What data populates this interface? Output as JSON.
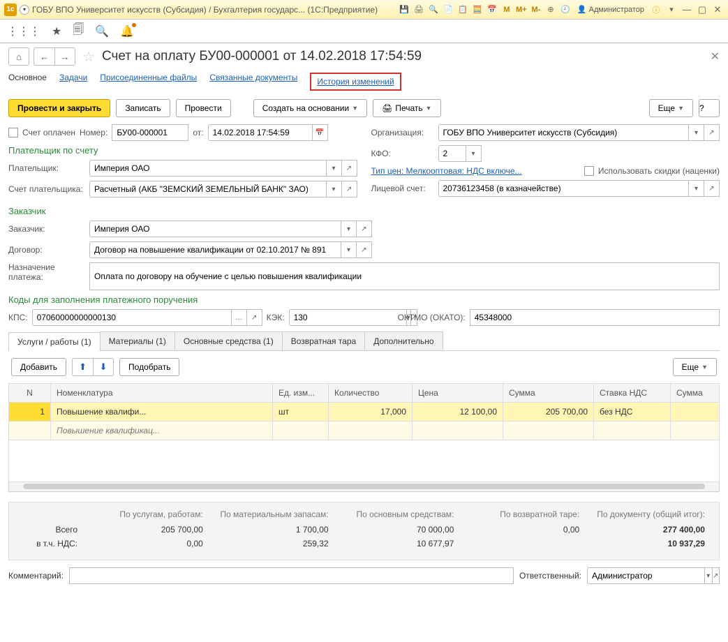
{
  "system": {
    "title": "ГОБУ ВПО Университет искусств (Субсидия) / Бухгалтерия государс... (1С:Предприятие)",
    "user": "Администратор"
  },
  "header": {
    "title": "Счет на оплату БУ00-000001 от 14.02.2018 17:54:59"
  },
  "nav": {
    "main": "Основное",
    "tasks": "Задачи",
    "files": "Присоединенные файлы",
    "linked": "Связанные документы",
    "history": "История изменений"
  },
  "cmd": {
    "post_close": "Провести и закрыть",
    "save": "Записать",
    "post": "Провести",
    "create_based": "Создать на основании",
    "print": "Печать",
    "more": "Еще",
    "help": "?"
  },
  "fields": {
    "paid_label": "Счет оплачен",
    "number_label": "Номер:",
    "number_value": "БУ00-000001",
    "from_label": "от:",
    "date_value": "14.02.2018 17:54:59",
    "org_label": "Организация:",
    "org_value": "ГОБУ ВПО Университет искусств (Субсидия)",
    "kfo_label": "КФО:",
    "kfo_value": "2",
    "payer_section": "Плательщик по счету",
    "payer_label": "Плательщик:",
    "payer_value": "Империя ОАО",
    "payer_acc_label": "Счет плательщика:",
    "payer_acc_value": "Расчетный (АКБ \"ЗЕМСКИЙ ЗЕМЕЛЬНЫЙ БАНК\" ЗАО)",
    "price_type_link": "Тип цен: Мелкооптовая: НДС включе...",
    "discount_label": "Использовать скидки (наценки)",
    "personal_acc_label": "Лицевой счет:",
    "personal_acc_value": "20736123458 (в казначействе)",
    "customer_section": "Заказчик",
    "customer_label": "Заказчик:",
    "customer_value": "Империя ОАО",
    "contract_label": "Договор:",
    "contract_value": "Договор на повышение квалификации от 02.10.2017 № 891",
    "purpose_label": "Назначение платежа:",
    "purpose_value": "Оплата по договору на обучение с целью повышения квалификации",
    "codes_section": "Коды для заполнения платежного поручения",
    "kps_label": "КПС:",
    "kps_value": "07060000000000130",
    "kek_label": "КЭК:",
    "kek_value": "130",
    "oktmo_label": "ОКТМО (ОКАТО):",
    "oktmo_value": "45348000"
  },
  "tabs": {
    "services": "Услуги / работы (1)",
    "materials": "Материалы (1)",
    "assets": "Основные средства (1)",
    "returnable": "Возвратная тара",
    "extra": "Дополнительно",
    "add": "Добавить",
    "pick": "Подобрать",
    "more": "Еще"
  },
  "table": {
    "cols": {
      "n": "N",
      "nomen": "Номенклатура",
      "unit": "Ед. изм...",
      "qty": "Количество",
      "price": "Цена",
      "sum": "Сумма",
      "vat_rate": "Ставка НДС",
      "sum2": "Сумма"
    },
    "rows": [
      {
        "n": "1",
        "nomen": "Повышение квалифи...",
        "nomen_sub": "Повышение квалификац...",
        "unit": "шт",
        "qty": "17,000",
        "price": "12 100,00",
        "sum": "205 700,00",
        "vat_rate": "без НДС",
        "sum2": ""
      }
    ]
  },
  "totals": {
    "h_services": "По услугам, работам:",
    "h_materials": "По материальным запасам:",
    "h_assets": "По основным средствам:",
    "h_returnable": "По возвратной таре:",
    "h_doc": "По документу (общий итог):",
    "r_total": "Всего",
    "r_vat": "в т.ч. НДС:",
    "v_serv_total": "205 700,00",
    "v_mat_total": "1 700,00",
    "v_ass_total": "70 000,00",
    "v_ret_total": "0,00",
    "v_doc_total": "277 400,00",
    "v_serv_vat": "0,00",
    "v_mat_vat": "259,32",
    "v_ass_vat": "10 677,97",
    "v_ret_vat": "",
    "v_doc_vat": "10 937,29"
  },
  "footer": {
    "comment_label": "Комментарий:",
    "resp_label": "Ответственный:",
    "resp_value": "Администратор"
  }
}
